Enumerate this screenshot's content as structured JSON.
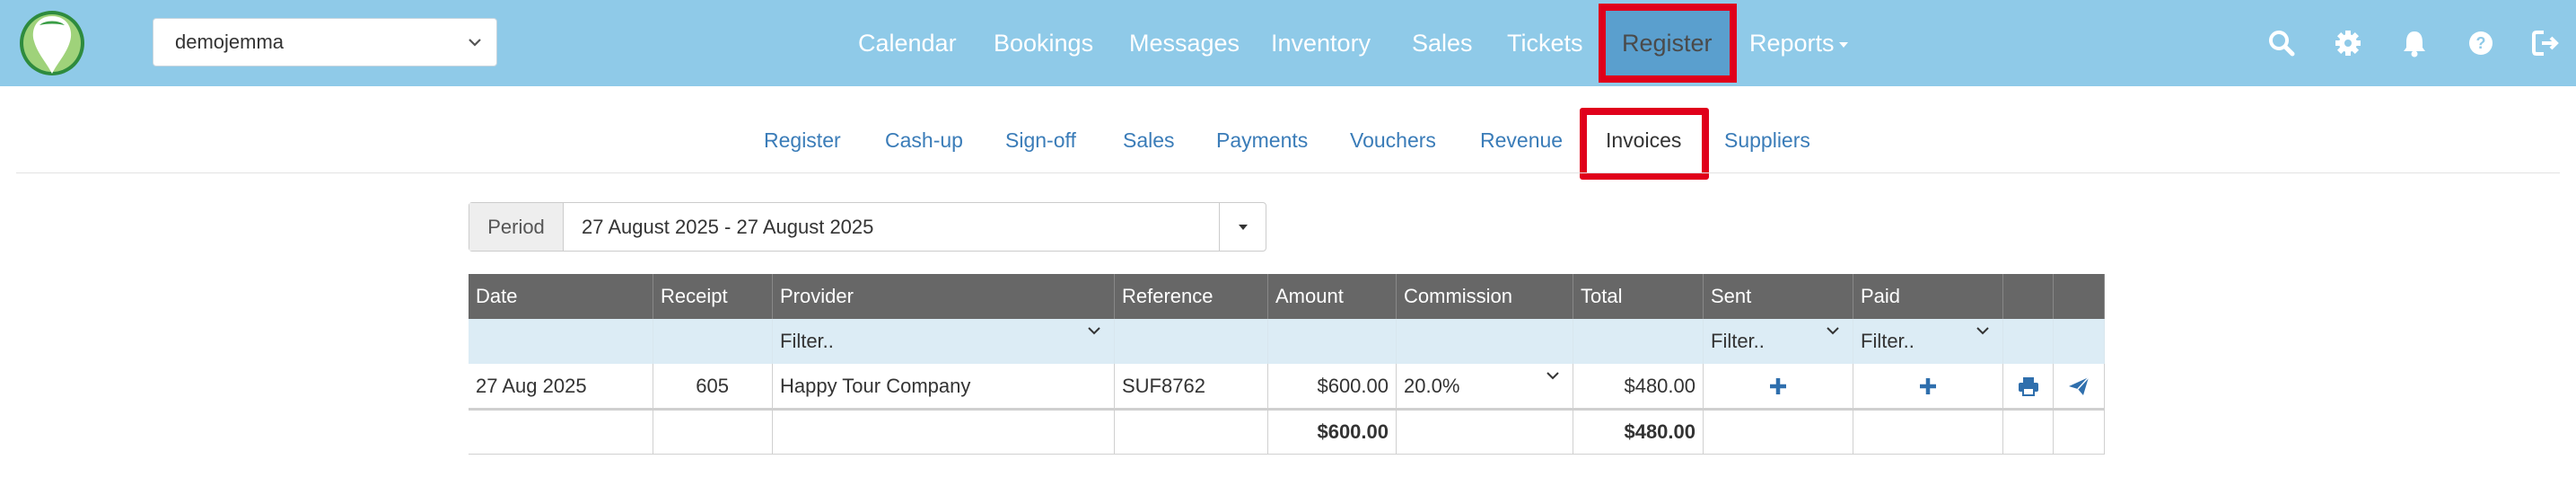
{
  "account": {
    "selected": "demojemma"
  },
  "main_nav": {
    "items": [
      "Calendar",
      "Bookings",
      "Messages",
      "Inventory",
      "Sales",
      "Tickets",
      "Register",
      "Reports"
    ],
    "active": "Register"
  },
  "top_icons": [
    "search-icon",
    "gear-icon",
    "bell-icon",
    "help-icon",
    "logout-icon"
  ],
  "sub_nav": {
    "items": [
      "Register",
      "Cash-up",
      "Sign-off",
      "Sales",
      "Payments",
      "Vouchers",
      "Revenue",
      "Invoices",
      "Suppliers"
    ],
    "active": "Invoices"
  },
  "period": {
    "label": "Period",
    "value": "27 August 2025 - 27 August 2025"
  },
  "table": {
    "headers": [
      "Date",
      "Receipt",
      "Provider",
      "Reference",
      "Amount",
      "Commission",
      "Total",
      "Sent",
      "Paid",
      "",
      ""
    ],
    "filters": {
      "provider": "Filter..",
      "sent": "Filter..",
      "paid": "Filter.."
    },
    "rows": [
      {
        "date": "27 Aug 2025",
        "receipt": "605",
        "provider": "Happy Tour Company",
        "reference": "SUF8762",
        "amount": "$600.00",
        "commission": "20.0%",
        "total": "$480.00"
      }
    ],
    "totals": {
      "amount": "$600.00",
      "total": "$480.00"
    }
  },
  "colors": {
    "topbar": "#8fcae8",
    "link": "#3a7cb8",
    "highlight": "#e0001b",
    "header": "#676767",
    "filter_row": "#dcecf5",
    "icon_blue": "#2f6fad"
  }
}
